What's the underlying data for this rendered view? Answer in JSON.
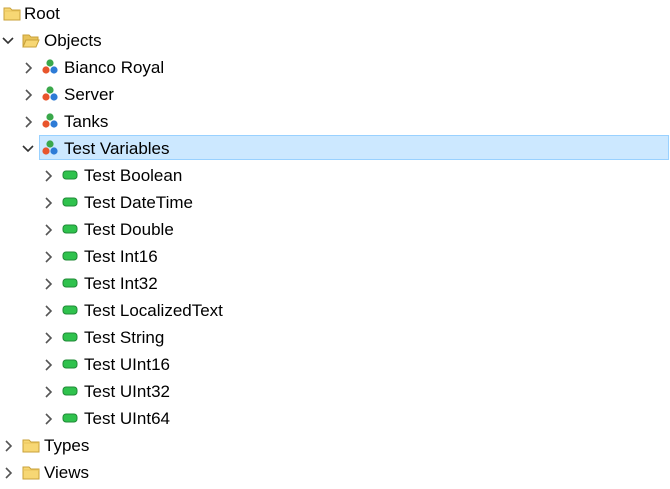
{
  "tree": {
    "root": {
      "label": "Root",
      "icon": "folder-icon"
    },
    "objects": {
      "label": "Objects",
      "icon": "folder-open-icon",
      "expanded": true
    },
    "object_children": [
      {
        "label": "Bianco Royal",
        "icon": "object-icon",
        "expanded": false
      },
      {
        "label": "Server",
        "icon": "object-icon",
        "expanded": false
      },
      {
        "label": "Tanks",
        "icon": "object-icon",
        "expanded": false
      },
      {
        "label": "Test Variables",
        "icon": "object-icon",
        "expanded": true,
        "selected": true
      }
    ],
    "test_variables": [
      {
        "label": "Test Boolean",
        "icon": "variable-icon"
      },
      {
        "label": "Test DateTime",
        "icon": "variable-icon"
      },
      {
        "label": "Test Double",
        "icon": "variable-icon"
      },
      {
        "label": "Test Int16",
        "icon": "variable-icon"
      },
      {
        "label": "Test Int32",
        "icon": "variable-icon"
      },
      {
        "label": "Test LocalizedText",
        "icon": "variable-icon"
      },
      {
        "label": "Test String",
        "icon": "variable-icon"
      },
      {
        "label": "Test UInt16",
        "icon": "variable-icon"
      },
      {
        "label": "Test UInt32",
        "icon": "variable-icon"
      },
      {
        "label": "Test UInt64",
        "icon": "variable-icon"
      }
    ],
    "types": {
      "label": "Types",
      "icon": "folder-icon",
      "expanded": false
    },
    "views": {
      "label": "Views",
      "icon": "folder-icon",
      "expanded": false
    }
  },
  "colors": {
    "selection_bg": "#cce8ff",
    "selection_border": "#99d1ff",
    "folder_fill": "#f7d774",
    "variable_green": "#2fc24d"
  }
}
